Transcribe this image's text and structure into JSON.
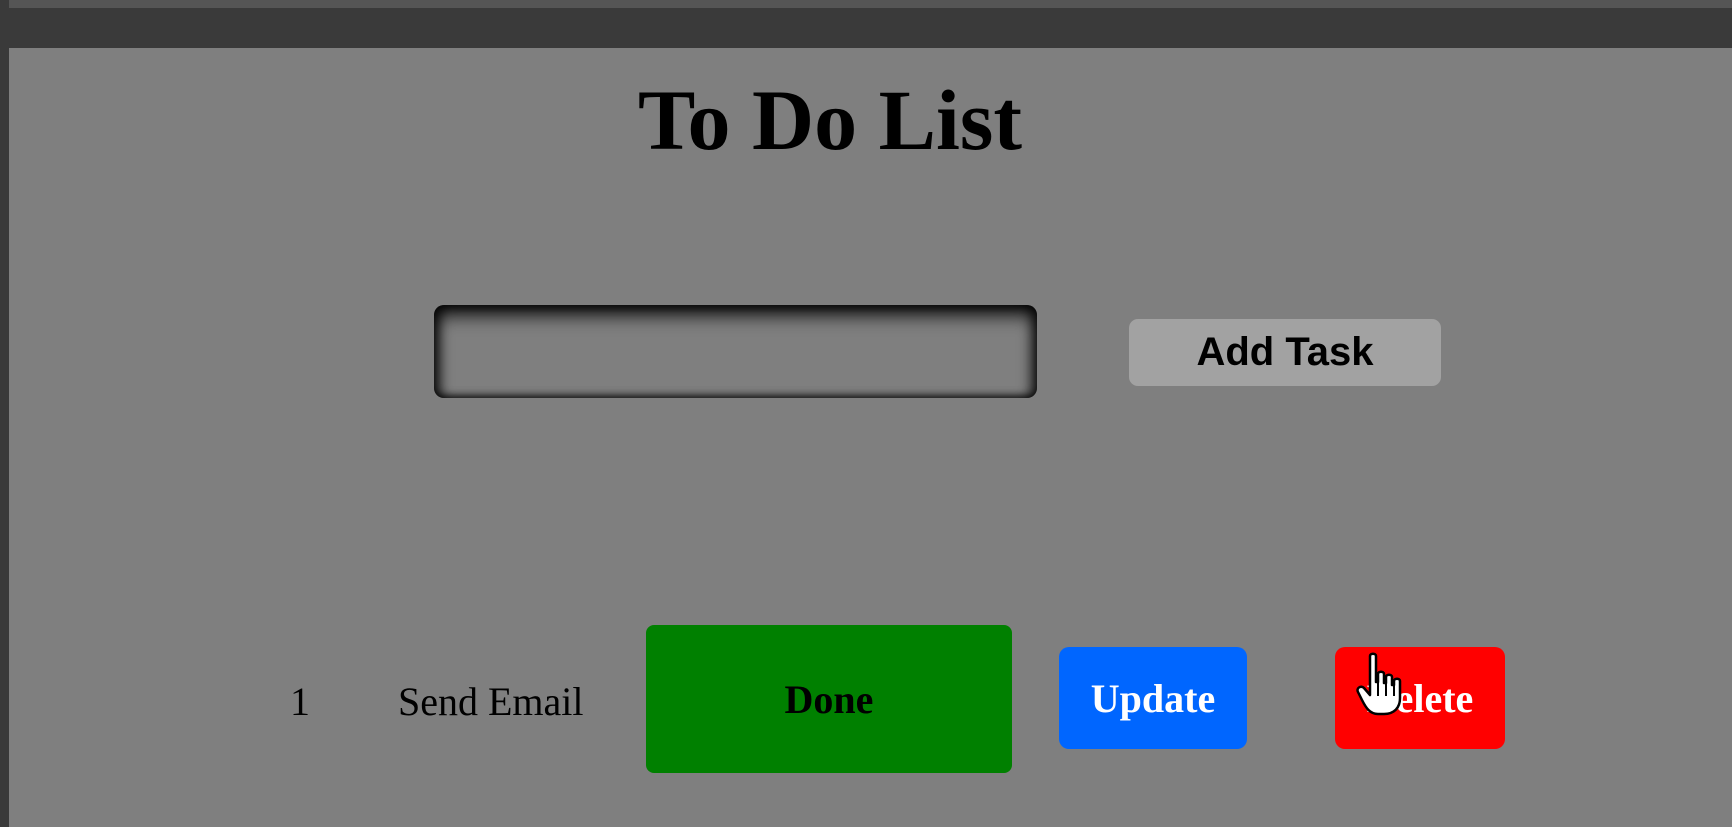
{
  "app": {
    "title": "To Do List"
  },
  "input": {
    "value": "",
    "placeholder": ""
  },
  "add_button": {
    "label": "Add Task"
  },
  "tasks": [
    {
      "number": "1",
      "text": "Send Email",
      "done_label": "Done",
      "update_label": "Update",
      "delete_label": "Delete"
    }
  ],
  "colors": {
    "background": "#7f7f7f",
    "done": "#008000",
    "update": "#0066ff",
    "delete": "#ff0000",
    "add_button": "#a2a2a2"
  }
}
